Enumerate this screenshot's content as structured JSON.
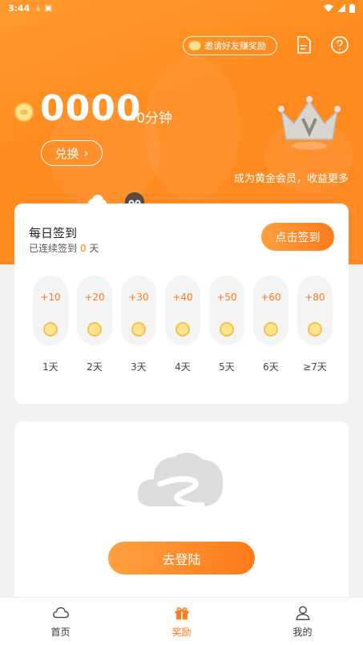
{
  "status_bar": {
    "time": "3:44"
  },
  "header": {
    "invite_label": "邀请好友赚奖励"
  },
  "balance": {
    "amount": "0000",
    "approx": "≈0分钟"
  },
  "exchange": {
    "label": "兑换"
  },
  "membership": {
    "text": "成为黄金会员，收益更多"
  },
  "checkin": {
    "title": "每日签到",
    "streak_prefix": "已连续签到",
    "streak_count": "0",
    "streak_suffix": "天",
    "button_label": "点击签到",
    "days": [
      {
        "points": "+10",
        "label": "1天"
      },
      {
        "points": "+20",
        "label": "2天"
      },
      {
        "points": "+30",
        "label": "3天"
      },
      {
        "points": "+40",
        "label": "4天"
      },
      {
        "points": "+50",
        "label": "5天"
      },
      {
        "points": "+60",
        "label": "6天"
      },
      {
        "points": "+80",
        "label": "≥7天"
      }
    ]
  },
  "login": {
    "button_label": "去登陆"
  },
  "tabs": [
    {
      "label": "首页",
      "icon": "cloud-icon"
    },
    {
      "label": "奖励",
      "icon": "gift-icon"
    },
    {
      "label": "我的",
      "icon": "person-icon"
    }
  ],
  "colors": {
    "accent": "#ff7a1a",
    "hero_orange": "#ff8a1e"
  }
}
